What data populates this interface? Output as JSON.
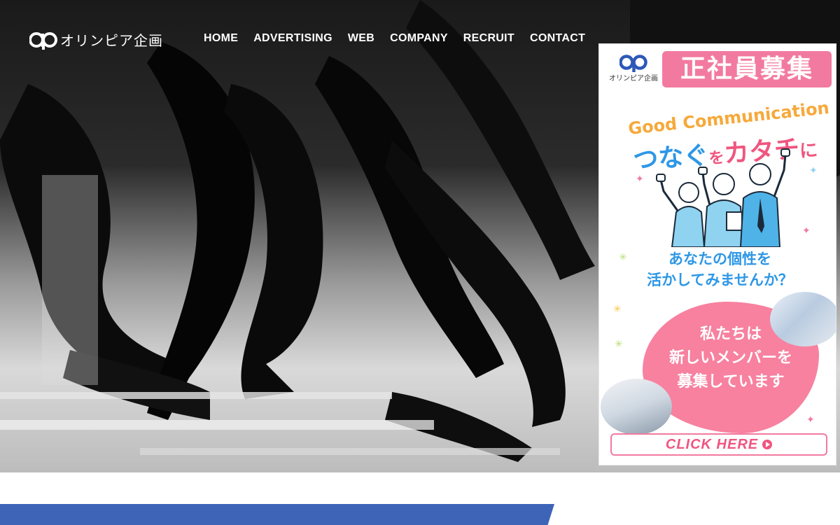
{
  "brand": {
    "logo_mark": "ap",
    "logo_text": "オリンピア企画"
  },
  "nav": {
    "items": [
      {
        "label": "HOME"
      },
      {
        "label": "ADVERTISING"
      },
      {
        "label": "WEB"
      },
      {
        "label": "COMPANY"
      },
      {
        "label": "RECRUIT"
      },
      {
        "label": "CONTACT"
      }
    ]
  },
  "banner": {
    "logo_mark": "ap",
    "logo_name": "オリンピア企画",
    "badge": "正社員募集",
    "tagline": "Good Communication",
    "headline_1": "つなぐ",
    "headline_2": "を",
    "headline_3": "カタチ",
    "headline_4": "に",
    "question_line1": "あなたの個性を",
    "question_line2": "活かしてみませんか？",
    "message_line1": "私たちは",
    "message_line2": "新しいメンバーを",
    "message_line3": "募集しています",
    "cta": "CLICK HERE"
  },
  "colors": {
    "accent_pink": "#f27aa0",
    "accent_blue": "#2e97e6",
    "band_blue": "#3e64b8"
  }
}
